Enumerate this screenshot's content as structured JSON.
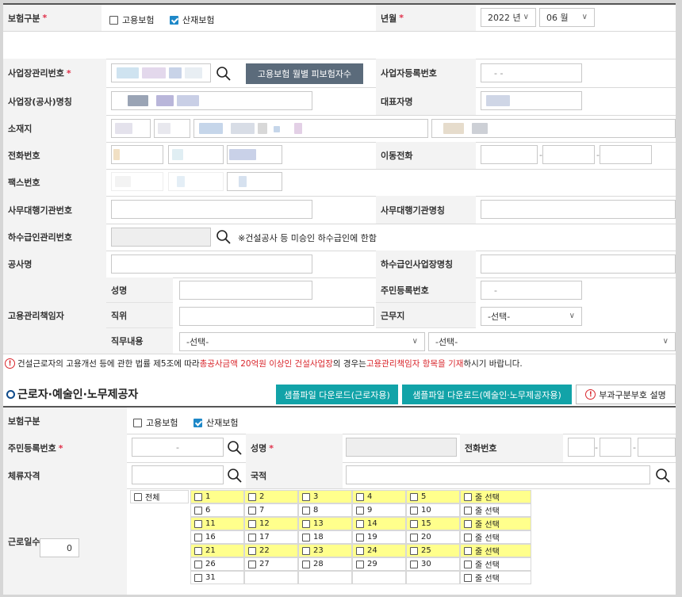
{
  "section1": {
    "insurance_label": "보험구분",
    "insurance_opt1": "고용보험",
    "insurance_opt2": "산재보험",
    "yearmonth_label": "년월",
    "year_value": "2022 년",
    "month_value": "06 월",
    "biz_mgmt_no_label": "사업장관리번호",
    "monthly_btn": "고용보험 월별 피보험자수",
    "biz_reg_no_label": "사업자등록번호",
    "biz_reg_no_value": "- -",
    "site_name_label": "사업장(공사)명칭",
    "rep_name_label": "대표자명",
    "address_label": "소재지",
    "phone_label": "전화번호",
    "mobile_label": "이동전화",
    "fax_label": "팩스번호",
    "agency_no_label": "사무대행기관번호",
    "agency_name_label": "사무대행기관명칭",
    "subcon_no_label": "하수급인관리번호",
    "subcon_note": "※건설공사 등 미승인 하수급인에 한함",
    "project_label": "공사명",
    "subcon_name_label": "하수급인사업장명칭",
    "manager_label": "고용관리책임자",
    "name_label": "성명",
    "rrn_label": "주민등록번호",
    "rrn_value": "-",
    "position_label": "직위",
    "workplace_label": "근무지",
    "workplace_value": "-선택-",
    "duty_label": "직무내용",
    "duty_sel1": "-선택-",
    "duty_sel2": "-선택-"
  },
  "notice": {
    "part1": "건설근로자의 고용개선 등에 관한 법률 제5조에 따라 ",
    "part2": "총공사금액 20억원 이상인 건설사업장",
    "part3": "의 경우는 ",
    "part4": "고용관리책임자 항목을 기재",
    "part5": "하시기 바랍니다."
  },
  "section2": {
    "title": "근로자·예술인·노무제공자",
    "btn_sample_worker": "샘플파일 다운로드(근로자용)",
    "btn_sample_artist": "샘플파일 다운로드(예술인·노무제공자용)",
    "btn_levy_help": "부과구분부호 설명",
    "insurance_label": "보험구분",
    "insurance_opt1": "고용보험",
    "insurance_opt2": "산재보험",
    "rrn_label": "주민등록번호",
    "rrn_value": "-",
    "name_label": "성명",
    "phone_label": "전화번호",
    "stay_label": "체류자격",
    "nationality_label": "국적",
    "workdays_label": "근로일수",
    "workdays_value": "0",
    "all_label": "전체",
    "row_select_label": "줄 선택",
    "days": [
      "1",
      "2",
      "3",
      "4",
      "5",
      "6",
      "7",
      "8",
      "9",
      "10",
      "11",
      "12",
      "13",
      "14",
      "15",
      "16",
      "17",
      "18",
      "19",
      "20",
      "21",
      "22",
      "23",
      "24",
      "25",
      "26",
      "27",
      "28",
      "29",
      "30",
      "31"
    ]
  },
  "colors": {
    "required": "#e0304a",
    "teal_button": "#12a3a8",
    "dark_button": "#5b6b7b",
    "highlight": "#ffff8c",
    "check_blue": "#1e88c8"
  }
}
